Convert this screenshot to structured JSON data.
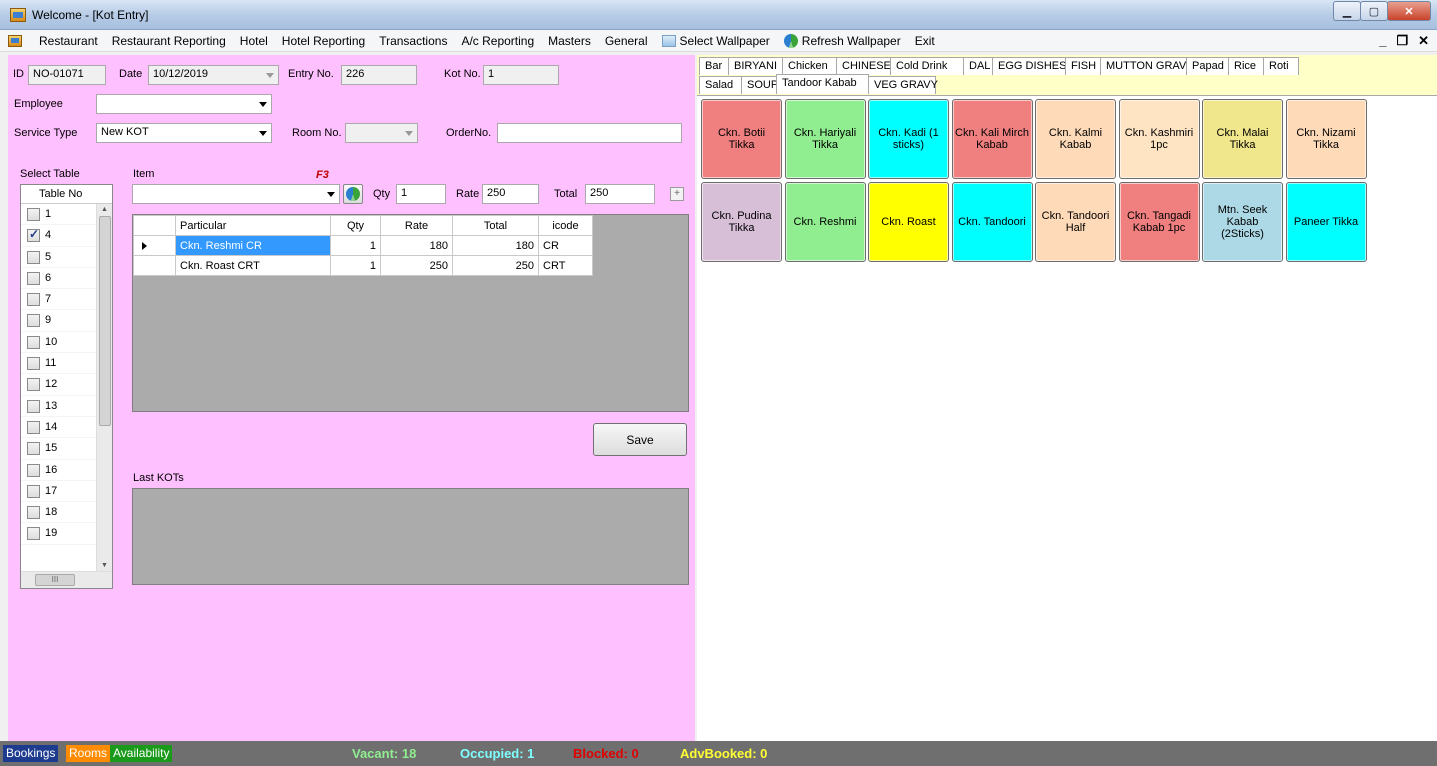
{
  "window": {
    "title": "Welcome - [Kot Entry]"
  },
  "menu": [
    "Restaurant",
    "Restaurant Reporting",
    "Hotel",
    "Hotel Reporting",
    "Transactions",
    "A/c Reporting",
    "Masters",
    "General"
  ],
  "menu_extra": {
    "select_wallpaper": "Select Wallpaper",
    "refresh_wallpaper": "Refresh Wallpaper",
    "exit": "Exit"
  },
  "form": {
    "id_label": "ID",
    "id_value": "NO-01071",
    "date_label": "Date",
    "date_value": "10/12/2019",
    "entry_label": "Entry No.",
    "entry_value": "226",
    "kot_label": "Kot No.",
    "kot_value": "1",
    "employee_label": "Employee",
    "employee_value": "",
    "service_label": "Service Type",
    "service_value": "New KOT",
    "room_label": "Room No.",
    "room_value": "",
    "order_label": "OrderNo.",
    "order_value": "",
    "select_table_label": "Select Table",
    "item_label": "Item",
    "item_shortcut": "F3",
    "item_value": "",
    "qty_label": "Qty",
    "qty_value": "1",
    "rate_label": "Rate",
    "rate_value": "250",
    "total_label": "Total",
    "total_value": "250",
    "save_label": "Save",
    "last_kots_label": "Last KOTs"
  },
  "table_list": {
    "header": "Table No",
    "rows": [
      {
        "no": "1",
        "checked": false
      },
      {
        "no": "4",
        "checked": true
      },
      {
        "no": "5",
        "checked": false
      },
      {
        "no": "6",
        "checked": false
      },
      {
        "no": "7",
        "checked": false
      },
      {
        "no": "9",
        "checked": false
      },
      {
        "no": "10",
        "checked": false
      },
      {
        "no": "11",
        "checked": false
      },
      {
        "no": "12",
        "checked": false
      },
      {
        "no": "13",
        "checked": false
      },
      {
        "no": "14",
        "checked": false
      },
      {
        "no": "15",
        "checked": false
      },
      {
        "no": "16",
        "checked": false
      },
      {
        "no": "17",
        "checked": false
      },
      {
        "no": "18",
        "checked": false
      },
      {
        "no": "19",
        "checked": false
      }
    ]
  },
  "grid": {
    "columns": [
      "Particular",
      "Qty",
      "Rate",
      "Total",
      "icode"
    ],
    "rows": [
      [
        "Ckn. Reshmi CR",
        "1",
        "180",
        "180",
        "CR"
      ],
      [
        "Ckn. Roast CRT",
        "1",
        "250",
        "250",
        "CRT"
      ]
    ]
  },
  "tabs_row1": [
    "Bar",
    "BIRYANI",
    "Chicken",
    "CHINESE",
    "Cold Drink",
    "DAL",
    "EGG DISHES",
    "FISH",
    "MUTTON GRAVY",
    "Papad",
    "Rice",
    "Roti"
  ],
  "tabs_row2": [
    "Salad",
    "SOUP",
    "Tandoor Kabab",
    "VEG GRAVY"
  ],
  "active_tab": "Tandoor Kabab",
  "tiles": [
    {
      "label": "Ckn. Botii Tikka",
      "color": "#f08080"
    },
    {
      "label": "Ckn. Hariyali Tikka",
      "color": "#90ee90"
    },
    {
      "label": "Ckn. Kadi (1 sticks)",
      "color": "#00ffff"
    },
    {
      "label": "Ckn. Kali Mirch Kabab",
      "color": "#f08080"
    },
    {
      "label": "Ckn. Kalmi Kabab",
      "color": "#ffdab9"
    },
    {
      "label": "Ckn. Kashmiri 1pc",
      "color": "#ffe4c4"
    },
    {
      "label": "Ckn. Malai Tikka",
      "color": "#f0e68c"
    },
    {
      "label": "Ckn. Nizami Tikka",
      "color": "#ffdab9"
    },
    {
      "label": "Ckn. Pudina Tikka",
      "color": "#d8bfd8"
    },
    {
      "label": "Ckn. Reshmi",
      "color": "#90ee90"
    },
    {
      "label": "Ckn. Roast",
      "color": "#ffff00"
    },
    {
      "label": "Ckn. Tandoori",
      "color": "#00ffff"
    },
    {
      "label": "Ckn. Tandoori Half",
      "color": "#ffdab9"
    },
    {
      "label": "Ckn. Tangadi Kabab 1pc",
      "color": "#f08080"
    },
    {
      "label": "Mtn. Seek Kabab (2Sticks)",
      "color": "#add8e6"
    },
    {
      "label": "Paneer Tikka",
      "color": "#00ffff"
    }
  ],
  "status": {
    "bookings": "Bookings",
    "rooms": "Rooms",
    "availability": "Availability",
    "vacant": "Vacant: 18",
    "occupied": "Occupied: 1",
    "blocked": "Blocked: 0",
    "advbooked": "AdvBooked: 0"
  }
}
